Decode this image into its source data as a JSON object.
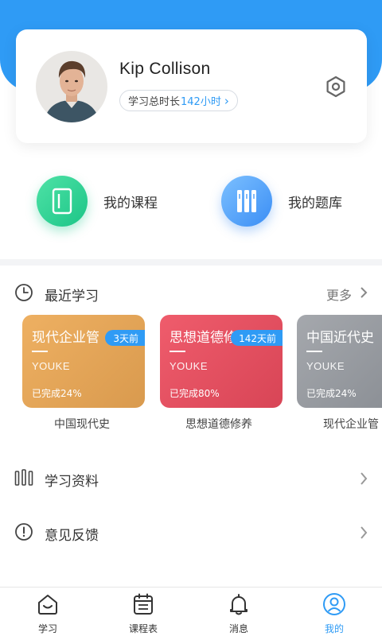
{
  "profile": {
    "name": "Kip Collison",
    "study_label": "学习总时长",
    "study_hours": "142小时",
    "avatar_icon": "user-avatar-photo",
    "settings_icon": "settings-hex-icon"
  },
  "quick_links": [
    {
      "label": "我的课程",
      "icon": "book-icon",
      "color": "#1cc587"
    },
    {
      "label": "我的题库",
      "icon": "question-bank-icon",
      "color": "#3b8ef5"
    }
  ],
  "recent": {
    "title": "最近学习",
    "more_label": "更多",
    "cards": [
      {
        "title": "现代企业管",
        "brand": "YOUKE",
        "progress": "已完成24%",
        "tag": "3天前",
        "caption": "中国现代史"
      },
      {
        "title": "思想道德修",
        "brand": "YOUKE",
        "progress": "已完成80%",
        "tag": "142天前",
        "caption": "思想道德修养"
      },
      {
        "title": "中国近代史",
        "brand": "YOUKE",
        "progress": "已完成24%",
        "tag": "",
        "caption": "现代企业管"
      }
    ]
  },
  "menu": [
    {
      "label": "学习资料",
      "icon": "bars-icon"
    },
    {
      "label": "意见反馈",
      "icon": "exclamation-icon"
    }
  ],
  "tabs": [
    {
      "label": "学习",
      "icon": "home-smile-icon",
      "active": false
    },
    {
      "label": "课程表",
      "icon": "calendar-icon",
      "active": false
    },
    {
      "label": "消息",
      "icon": "bell-icon",
      "active": false
    },
    {
      "label": "我的",
      "icon": "user-circle-icon",
      "active": true
    }
  ],
  "colors": {
    "primary": "#2f9bf5",
    "green": "#1cc587",
    "orange_card": "#e4a457",
    "red_card": "#e2505f",
    "gray_card": "#979ba0"
  }
}
